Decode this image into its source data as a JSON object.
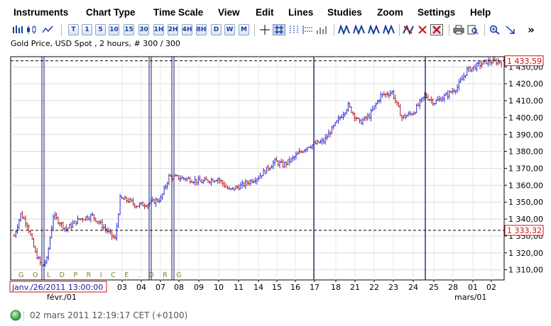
{
  "menu": [
    "Instruments",
    "Chart Type",
    "Time Scale",
    "View",
    "Edit",
    "Lines",
    "Studies",
    "Zoom",
    "Settings",
    "Help"
  ],
  "toolbar": {
    "period_buttons": [
      "T",
      "1",
      "5",
      "10",
      "15",
      "30",
      "1H",
      "2H",
      "4H",
      "8H",
      "D",
      "W",
      "M"
    ],
    "more_label": "»"
  },
  "chart_title": "Gold Price, USD Spot , 2 hours, # 300 / 300",
  "watermark": "GOLDPRICE.ORG",
  "current_date_box": "janv./26/2011 13:00:00",
  "status_text": "02 mars 2011 12:19:17  CET (+0100)",
  "colors": {
    "up": "#2b2bd6",
    "down": "#b21c1c",
    "vline": "#14146e",
    "price_box": "#d01010",
    "status_dot": "#2d9b3a"
  },
  "chart_data": {
    "type": "bar",
    "subtype": "ohlc",
    "y_ticks": [
      "1 310,00",
      "1 320,00",
      "1 330,00",
      "1 340,00",
      "1 350,00",
      "1 360,00",
      "1 370,00",
      "1 380,00",
      "1 390,00",
      "1 400,00",
      "1 410,00",
      "1 420,00",
      "1 430,00"
    ],
    "ylim": [
      1304,
      1436
    ],
    "grid": true,
    "x_ticks": [
      "03",
      "04",
      "07",
      "08",
      "09",
      "10",
      "11",
      "14",
      "15",
      "16",
      "17",
      "18",
      "21",
      "22",
      "23",
      "24",
      "25",
      "28",
      "01",
      "02"
    ],
    "x_month_labels": [
      "févr./01",
      "mars/01"
    ],
    "price_labels": [
      "1 433,59",
      "1 333,32"
    ],
    "ref_levels": [
      1433.59,
      1333.32
    ],
    "anchors": [
      {
        "i": 0,
        "v": 1330
      },
      {
        "i": 4,
        "v": 1343
      },
      {
        "i": 8,
        "v": 1337
      },
      {
        "i": 13,
        "v": 1320
      },
      {
        "i": 17,
        "v": 1312
      },
      {
        "i": 20,
        "v": 1316
      },
      {
        "i": 24,
        "v": 1342
      },
      {
        "i": 32,
        "v": 1334
      },
      {
        "i": 40,
        "v": 1340
      },
      {
        "i": 48,
        "v": 1342
      },
      {
        "i": 58,
        "v": 1332
      },
      {
        "i": 62,
        "v": 1328
      },
      {
        "i": 65,
        "v": 1352
      },
      {
        "i": 70,
        "v": 1351
      },
      {
        "i": 75,
        "v": 1348
      },
      {
        "i": 82,
        "v": 1349
      },
      {
        "i": 90,
        "v": 1352
      },
      {
        "i": 95,
        "v": 1365
      },
      {
        "i": 105,
        "v": 1364
      },
      {
        "i": 115,
        "v": 1362
      },
      {
        "i": 125,
        "v": 1364
      },
      {
        "i": 132,
        "v": 1357
      },
      {
        "i": 140,
        "v": 1360
      },
      {
        "i": 150,
        "v": 1365
      },
      {
        "i": 160,
        "v": 1374
      },
      {
        "i": 165,
        "v": 1372
      },
      {
        "i": 170,
        "v": 1375
      },
      {
        "i": 180,
        "v": 1383
      },
      {
        "i": 190,
        "v": 1386
      },
      {
        "i": 200,
        "v": 1400
      },
      {
        "i": 205,
        "v": 1407
      },
      {
        "i": 212,
        "v": 1397
      },
      {
        "i": 218,
        "v": 1401
      },
      {
        "i": 225,
        "v": 1413
      },
      {
        "i": 232,
        "v": 1415
      },
      {
        "i": 238,
        "v": 1400
      },
      {
        "i": 245,
        "v": 1403
      },
      {
        "i": 252,
        "v": 1413
      },
      {
        "i": 258,
        "v": 1409
      },
      {
        "i": 265,
        "v": 1413
      },
      {
        "i": 272,
        "v": 1418
      },
      {
        "i": 278,
        "v": 1428
      },
      {
        "i": 285,
        "v": 1431
      },
      {
        "i": 290,
        "v": 1433
      }
    ]
  }
}
